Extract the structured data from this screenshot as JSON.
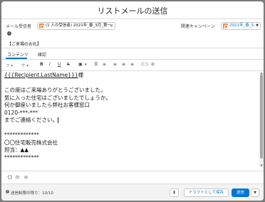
{
  "header": {
    "title": "リストメールの送信"
  },
  "recipient": {
    "label": "メール受信者",
    "value": "(1 人の受信者) 2021年_春_3月_第一",
    "remove": "✕"
  },
  "campaign": {
    "label": "関連キャンペーン",
    "value": "2021年_春_3...",
    "dropdown": "▼"
  },
  "subject": {
    "value": "【ご来場のお礼】"
  },
  "tabs": [
    {
      "label": "コンテンツ"
    },
    {
      "label": "確認"
    }
  ],
  "toolbar": {
    "font": "フ",
    "size": "サ",
    "bold": "B",
    "italic": "I",
    "underline": "U",
    "strike": "S",
    "chevron": "▾",
    "bullets": "☰",
    "numbers": "≡"
  },
  "body": {
    "merge_field": "{{{Recipient.LastName}}}",
    "honorific": "様",
    "lines": [
      "この度はご来場ありがとうございました。",
      "気に入った住宅はございましたでしょうか。",
      "何か御座いましたら弊社お客様窓口",
      "0120-***-***",
      "までご連絡ください。",
      "",
      "*************",
      "〇〇住宅販売株式会社",
      "担当：▲▲",
      "*************"
    ]
  },
  "footer": {
    "remaining": "送信制限の残り：10/10",
    "draft_button": "ドラフトとして保存",
    "send_button": "送信",
    "more": "▼"
  }
}
